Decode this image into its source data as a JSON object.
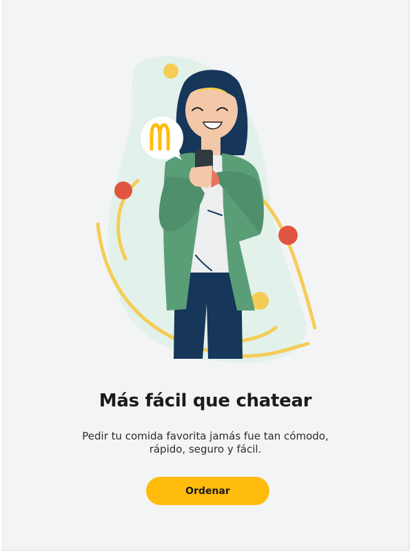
{
  "onboarding": {
    "title": "Más fácil que chatear",
    "subtitle": "Pedir tu comida favorita jamás fue tan cómodo, rápido, seguro y fácil.",
    "cta_label": "Ordenar"
  },
  "illustration": {
    "logo_icon": "mcdonalds-arches-icon",
    "subject": "woman-with-phone",
    "colors": {
      "brand_yellow": "#ffbc0d",
      "arc_yellow": "#f5cd55",
      "dot_red": "#e0553f",
      "jacket_green": "#5a9e78",
      "hair_navy": "#16365a",
      "blob_mint": "#e2f1ea"
    }
  }
}
